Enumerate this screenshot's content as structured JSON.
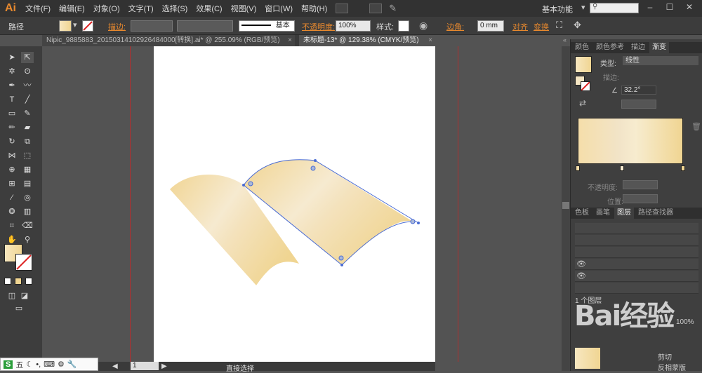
{
  "app": {
    "logo": "Ai",
    "workspace": "基本功能",
    "search_icon": "search-icon"
  },
  "menu": [
    "文件(F)",
    "编辑(E)",
    "对象(O)",
    "文字(T)",
    "选择(S)",
    "效果(C)",
    "视图(V)",
    "窗口(W)",
    "帮助(H)"
  ],
  "control_bar": {
    "selection_label": "路径",
    "stroke_label": "描边:",
    "stroke_profile": "基本",
    "opacity_label": "不透明度:",
    "opacity_value": "100%",
    "style_label": "样式:",
    "corner_label": "边角:",
    "corner_value": "0 mm",
    "align_label": "对齐",
    "transform_label": "变换"
  },
  "tabs": [
    {
      "label": "Nipic_9885883_20150314102926484000[转换].ai* @ 255.09% (RGB/预览)",
      "active": false
    },
    {
      "label": "未标题-13* @ 129.38% (CMYK/预览)",
      "active": true
    }
  ],
  "status": {
    "zoom": "",
    "page": "1",
    "tool": "直接选择"
  },
  "gradient_panel": {
    "tabs": [
      "颜色",
      "颜色参考",
      "描边",
      "渐变"
    ],
    "type_label": "类型:",
    "type_value": "线性",
    "stroke_label": "描边:",
    "angle_value": "32.2°",
    "opacity_label": "不透明度:",
    "position_label": "位置:"
  },
  "layers_panel": {
    "tabs": [
      "色板",
      "画笔",
      "图层",
      "路径查找器"
    ],
    "footer": "1 个图层"
  },
  "transparency_panel": {
    "value": "100%",
    "clip_label": "剪切",
    "invert_label": "反相蒙版"
  },
  "taskbar": {
    "ime": "S",
    "mode": "五"
  },
  "watermark": "Bai经验",
  "colors": {
    "gradient_light": "#f5e6c4",
    "gradient_dark": "#f0d592",
    "guide_red": "#b12f2f",
    "accent_orange": "#e8892e"
  }
}
